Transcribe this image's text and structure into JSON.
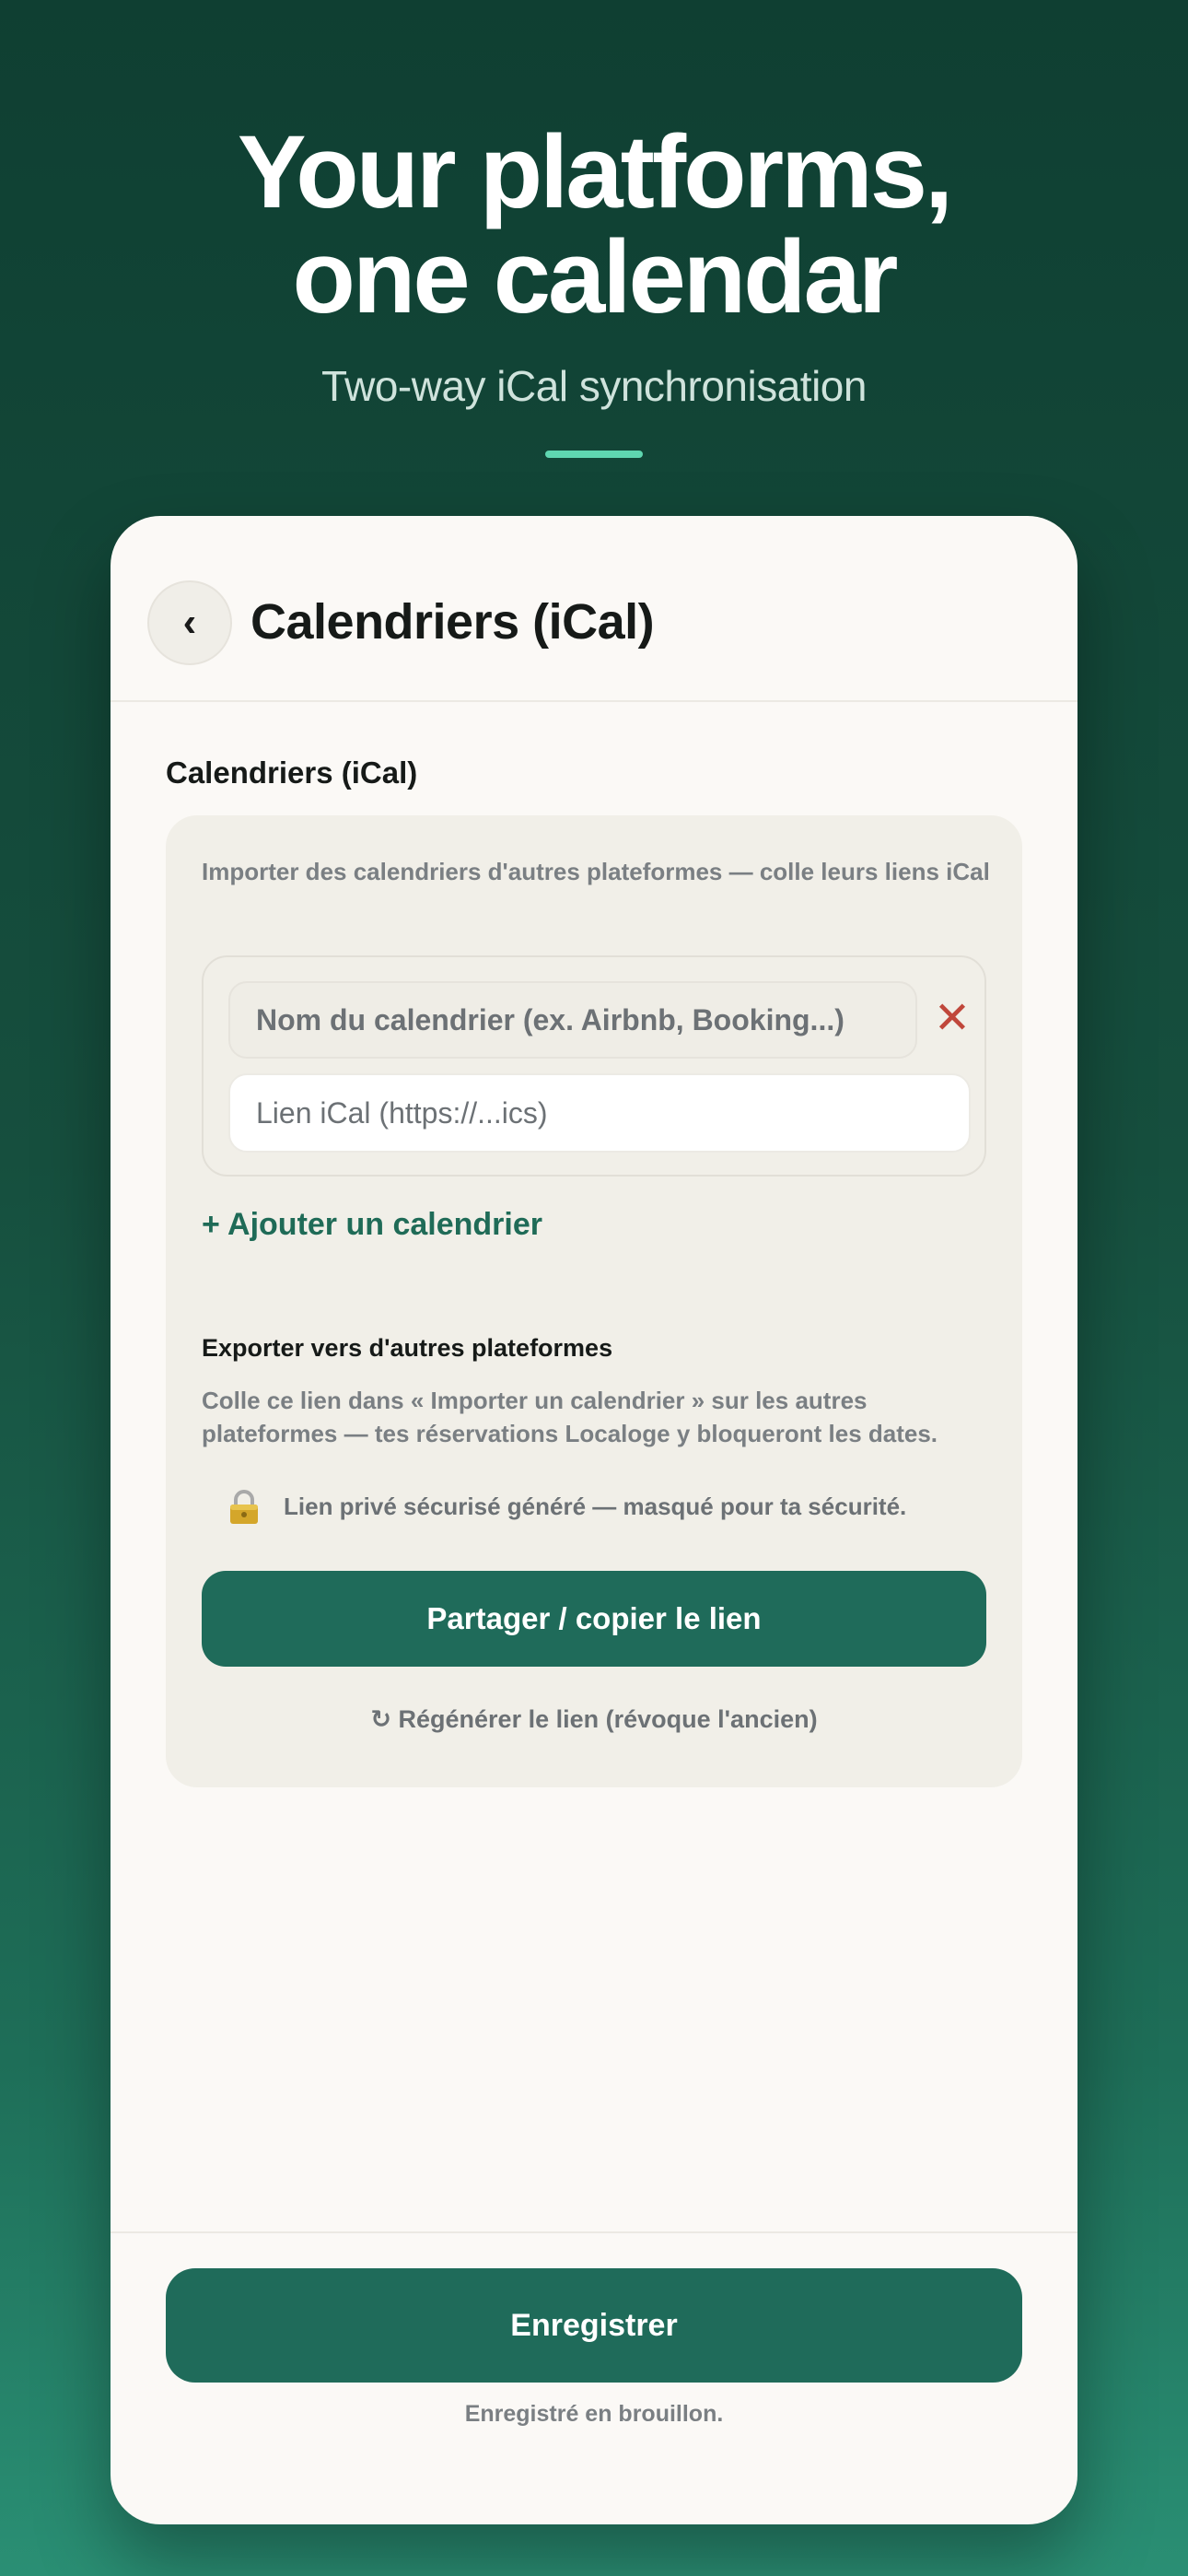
{
  "hero": {
    "title_line1": "Your platforms,",
    "title_line2": "one calendar",
    "subtitle": "Two-way iCal synchronisation"
  },
  "header": {
    "back_icon": "chevron-left-icon",
    "back_glyph": "‹",
    "title": "Calendriers (iCal)"
  },
  "import_section": {
    "heading": "Calendriers (iCal)",
    "intro": "Importer des calendriers d'autres plateformes — colle leurs liens iCal",
    "calendar_row": {
      "name_placeholder": "Nom du calendrier (ex. Airbnb, Booking...)",
      "url_placeholder": "Lien iCal (https://...ics)",
      "remove_glyph": "✕"
    },
    "add_label": "+ Ajouter un calendrier"
  },
  "export_section": {
    "heading": "Exporter vers d'autres plateformes",
    "description": "Colle ce lien dans « Importer un calendrier » sur les autres plateformes — tes réservations Localoge y bloqueront les dates.",
    "lock_icon": "lock-icon",
    "private_link_note": "Lien privé sécurisé généré — masqué pour ta sécurité.",
    "share_button": "Partager / copier le lien",
    "regenerate_link": "↻ Régénérer le lien (révoque l'ancien)"
  },
  "footer": {
    "save_button": "Enregistrer",
    "status": "Enregistré en brouillon."
  },
  "colors": {
    "accent": "#1f6b5a",
    "danger": "#c0473b",
    "hero_bar": "#5fd6b0"
  }
}
